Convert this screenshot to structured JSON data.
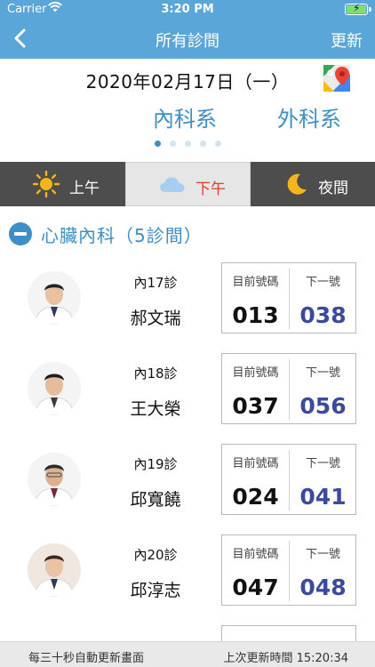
{
  "status_bar": {
    "carrier": "Carrier",
    "time": "3:20 PM"
  },
  "nav": {
    "title": "所有診間",
    "refresh_label": "更新"
  },
  "date": "2020年02月17日（一）",
  "departments": [
    "內科系",
    "外科系"
  ],
  "page_dots": {
    "count": 5,
    "active_index": 0
  },
  "time_segments": [
    {
      "label": "上午",
      "icon": "sun-icon",
      "selected": false
    },
    {
      "label": "下午",
      "icon": "cloud-icon",
      "selected": true
    },
    {
      "label": "夜間",
      "icon": "moon-icon",
      "selected": false
    }
  ],
  "section": {
    "title": "心臟內科（5診間）"
  },
  "board_headers": {
    "current": "目前號碼",
    "next": "下一號"
  },
  "clinics": [
    {
      "room": "內17診",
      "doctor": "郝文瑞",
      "current": "013",
      "next": "038"
    },
    {
      "room": "內18診",
      "doctor": "王大榮",
      "current": "037",
      "next": "056"
    },
    {
      "room": "內19診",
      "doctor": "邱寬饒",
      "current": "024",
      "next": "041"
    },
    {
      "room": "內20診",
      "doctor": "邱淳志",
      "current": "047",
      "next": "048"
    }
  ],
  "footer": {
    "auto_refresh": "每三十秒自動更新畫面",
    "last_update": "上次更新時間 15:20:34"
  },
  "colors": {
    "header_bg": "#5aa6d8",
    "accent": "#3e8fc8",
    "next_number": "#3b4a9c",
    "selected_segment_text": "#e33b2c"
  }
}
